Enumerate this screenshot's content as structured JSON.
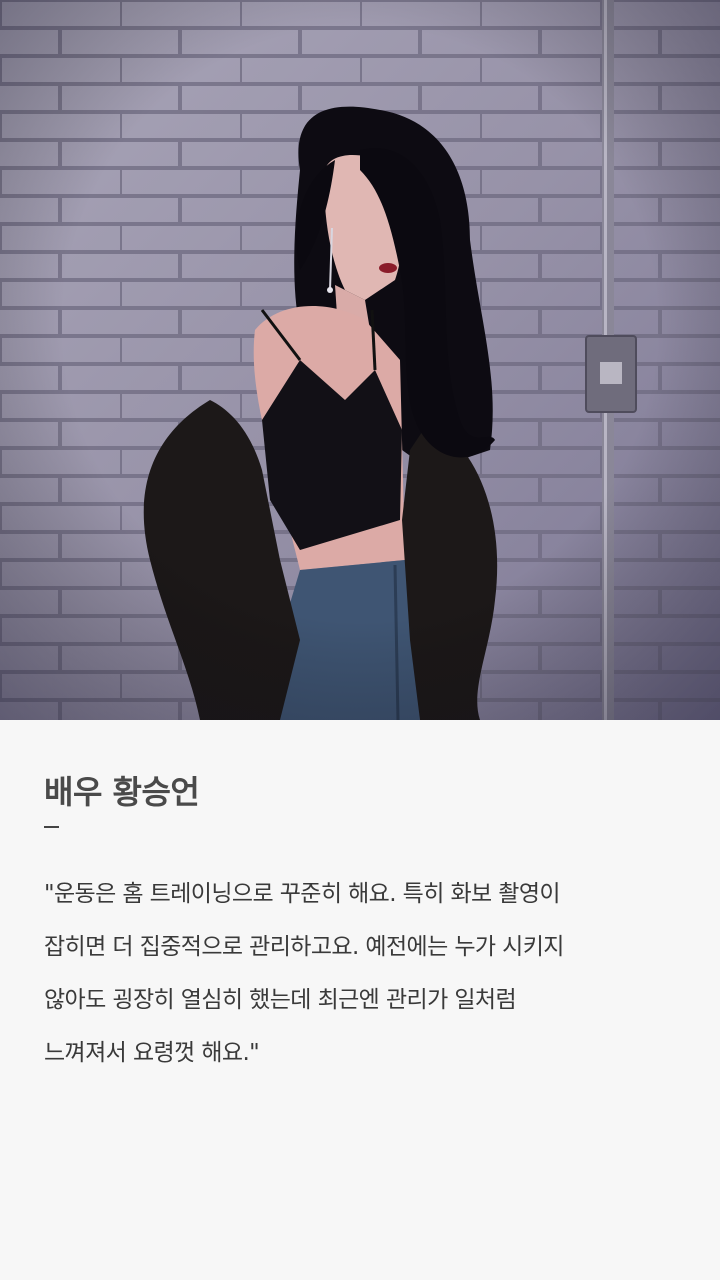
{
  "profile": {
    "image_alt": "배우 황승언",
    "name": "배우 황승언",
    "divider": "–",
    "quote_lines": [
      "\"운동은 홈 트레이닝으로 꾸준히 해요. 특히 화보 촬영이",
      "잡히면 더 집중적으로 관리하고요. 예전에는 누가 시키지",
      "않아도 굉장히 열심히 했는데 최근엔 관리가 일처럼",
      "느껴져서 요령껏 해요.\""
    ]
  },
  "colors": {
    "background": "#f7f7f7",
    "title": "#4a4a4a",
    "body": "#3a3a3a"
  }
}
